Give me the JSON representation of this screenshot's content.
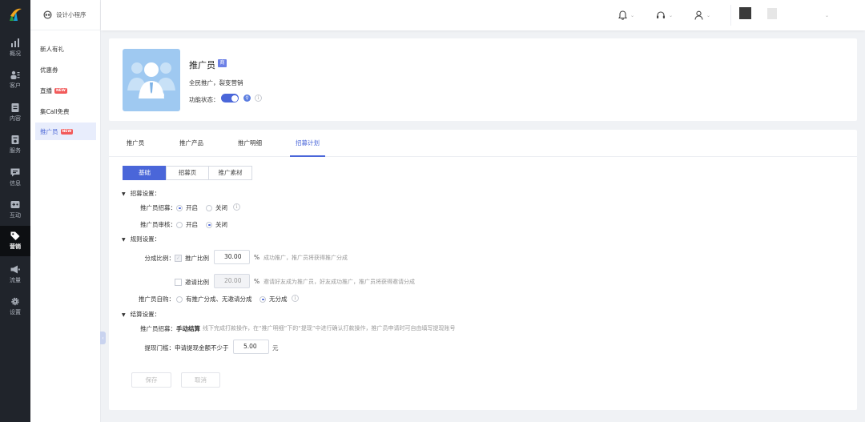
{
  "brand": {
    "app_name": "设计小程序"
  },
  "rail": [
    {
      "label": "概况",
      "icon": "chart-icon"
    },
    {
      "label": "客户",
      "icon": "customers-icon"
    },
    {
      "label": "内容",
      "icon": "document-icon"
    },
    {
      "label": "服务",
      "icon": "service-icon"
    },
    {
      "label": "信息",
      "icon": "message-icon"
    },
    {
      "label": "互动",
      "icon": "gamepad-icon"
    },
    {
      "label": "营销",
      "icon": "tag-icon",
      "active": true
    },
    {
      "label": "流量",
      "icon": "megaphone-icon"
    },
    {
      "label": "设置",
      "icon": "gear-icon"
    }
  ],
  "submenu": [
    {
      "label": "新人有礼"
    },
    {
      "label": "优惠券"
    },
    {
      "label": "直播",
      "badge": "NEW"
    },
    {
      "label": "集Call免费"
    },
    {
      "label": "推广员",
      "badge": "NEW",
      "active": true
    }
  ],
  "product": {
    "title": "推广员",
    "tag": "商",
    "desc": "全民推广，裂变营销",
    "status_label": "功能状态：",
    "status_on": true
  },
  "tabs": [
    "推广员",
    "推广产品",
    "推广明细",
    "招募计划"
  ],
  "segments": [
    "基础",
    "招募页",
    "推广素材"
  ],
  "recruit": {
    "section": "招募设置：",
    "enable_label": "推广员招募：",
    "enable_options": [
      "开启",
      "关闭"
    ],
    "audit_label": "推广员审核：",
    "audit_options": [
      "开启",
      "关闭"
    ]
  },
  "rules": {
    "section": "规则设置：",
    "split_label": "分成比例：",
    "promo_label": "推广比例",
    "promo_value": "30.00",
    "promo_hint": "成功推广，推广员将获得推广分成",
    "invite_label": "邀请比例",
    "invite_value": "20.00",
    "invite_hint": "邀请好友成为推广员，好友成功推广，推广员将获得邀请分成",
    "percent": "%",
    "self_label": "推广员自购：",
    "self_options": [
      "有推广分成、无邀请分成",
      "无分成"
    ]
  },
  "settle": {
    "section": "结算设置：",
    "mode_label": "推广员招募：",
    "mode_value": "手动结算",
    "mode_hint": "线下完成打款操作，在“推广明细”下的“提现”中进行确认打款操作，推广员申请时可自由填写提现账号",
    "threshold_label": "提现门槛：",
    "threshold_text": "申请提现金额不少于",
    "threshold_value": "5.00",
    "unit": "元"
  },
  "actions": {
    "save": "保存",
    "cancel": "取消"
  },
  "colors": {
    "accent": "#4a66d9",
    "rail_bg": "#20242b",
    "badge": "#f25a5a"
  }
}
